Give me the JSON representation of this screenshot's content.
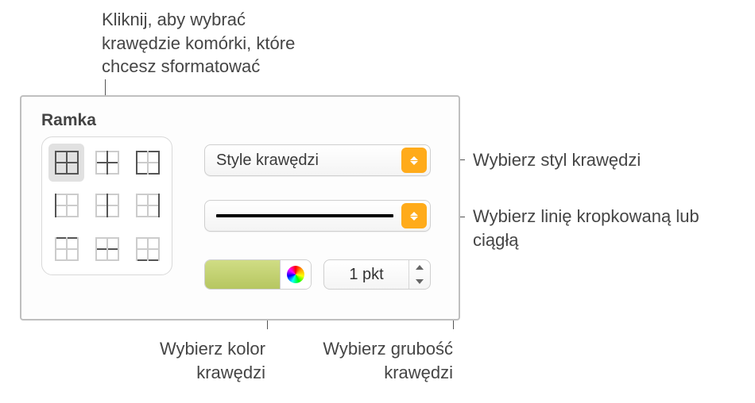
{
  "callouts": {
    "edges": "Kliknij, aby wybrać krawędzie komórki, które chcesz sformatować",
    "style": "Wybierz styl krawędzi",
    "line": "Wybierz linię kropkowaną lub ciągłą",
    "color": "Wybierz kolor krawędzi",
    "width": "Wybierz grubość krawędzi"
  },
  "panel": {
    "section_title": "Ramka",
    "style_dropdown": "Style krawędzi",
    "width_value": "1 pkt",
    "color_swatch_hex": "#c4d272"
  }
}
